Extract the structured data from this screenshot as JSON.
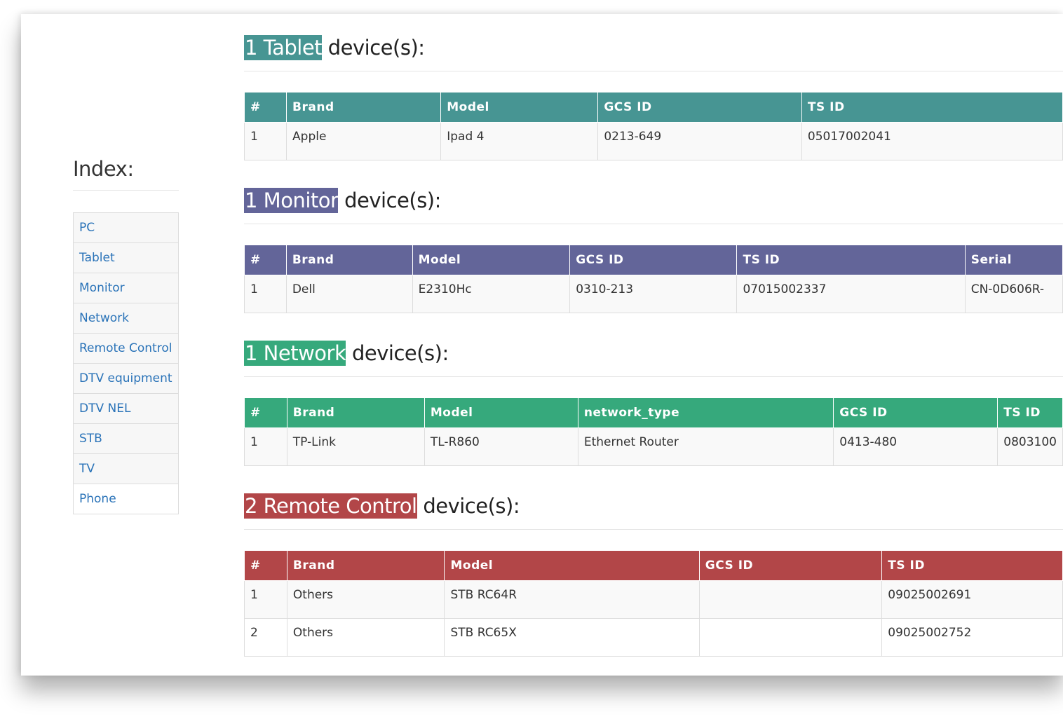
{
  "index": {
    "title": "Index:",
    "items": [
      "PC",
      "Tablet",
      "Monitor",
      "Network",
      "Remote Control",
      "DTV equipment",
      "DTV NEL",
      "STB",
      "TV",
      "Phone"
    ]
  },
  "colors": {
    "tablet": "#479593",
    "monitor": "#636599",
    "network": "#36a97c",
    "remote": "#b24648",
    "link": "#2a73b8"
  },
  "sections": {
    "tablet": {
      "badge": "1 Tablet",
      "suffix": " device(s):",
      "headers": [
        "#",
        "Brand",
        "Model",
        "GCS ID",
        "TS ID"
      ],
      "rows": [
        [
          "1",
          "Apple",
          "Ipad 4",
          "0213-649",
          "05017002041"
        ]
      ]
    },
    "monitor": {
      "badge": "1 Monitor",
      "suffix": " device(s):",
      "headers": [
        "#",
        "Brand",
        "Model",
        "GCS ID",
        "TS ID",
        "Serial"
      ],
      "rows": [
        [
          "1",
          "Dell",
          "E2310Hc",
          "0310-213",
          "07015002337",
          "CN-0D606R-"
        ]
      ]
    },
    "network": {
      "badge": "1 Network",
      "suffix": " device(s):",
      "headers": [
        "#",
        "Brand",
        "Model",
        "network_type",
        "GCS ID",
        "TS ID"
      ],
      "rows": [
        [
          "1",
          "TP-Link",
          "TL-R860",
          "Ethernet Router",
          "0413-480",
          "0803100"
        ]
      ]
    },
    "remote": {
      "badge": "2 Remote Control",
      "suffix": " device(s):",
      "headers": [
        "#",
        "Brand",
        "Model",
        "GCS ID",
        "TS ID"
      ],
      "rows": [
        [
          "1",
          "Others",
          "STB RC64R",
          "",
          "09025002691"
        ],
        [
          "2",
          "Others",
          "STB RC65X",
          "",
          "09025002752"
        ]
      ]
    }
  }
}
